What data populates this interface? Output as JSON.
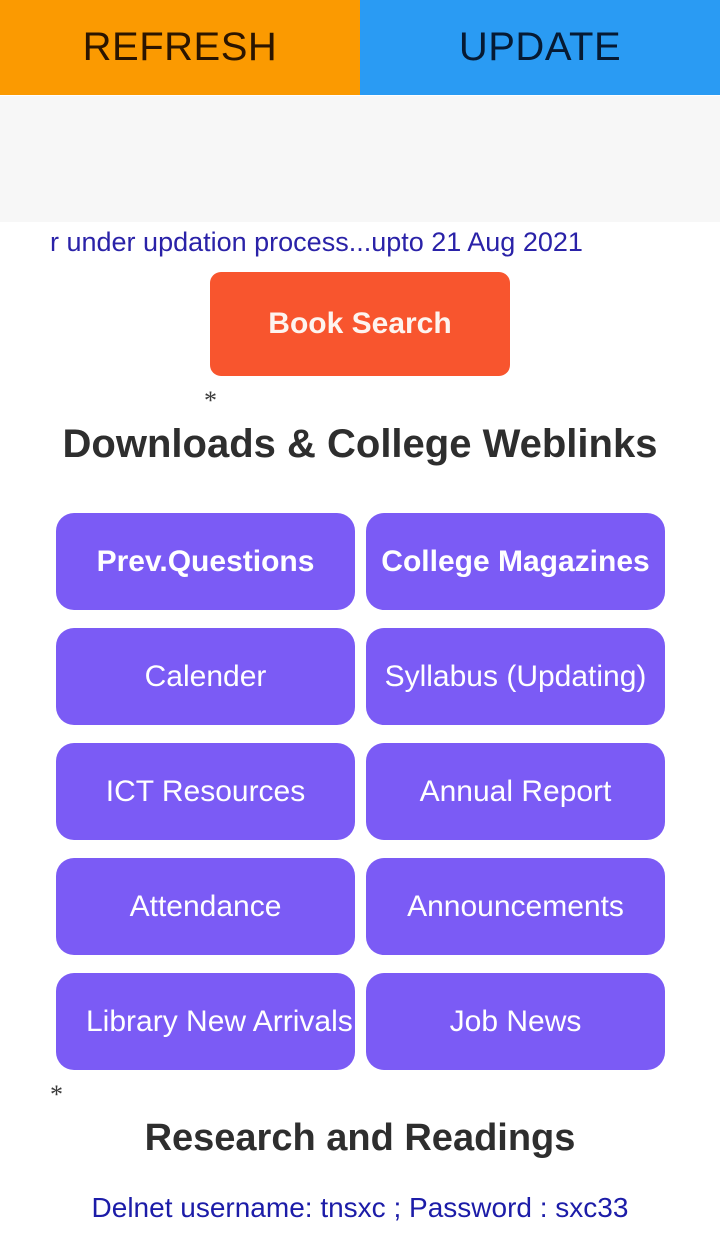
{
  "top_bar": {
    "refresh_label": "REFRESH",
    "update_label": "UPDATE",
    "refresh_color": "#FB9A01",
    "update_color": "#2A9BF3"
  },
  "notice": {
    "marquee_text": "r under updation process...upto 21 Aug 2021",
    "color": "#2A22A8"
  },
  "book_search": {
    "label": "Book Search",
    "color": "#F8552E"
  },
  "markers": {
    "asterisk": "*"
  },
  "downloads_section": {
    "heading": "Downloads & College Weblinks",
    "button_color": "#7B5BF5",
    "buttons": [
      {
        "label": "Prev.Questions",
        "bold": true,
        "overflow": false
      },
      {
        "label": "College Magazines",
        "bold": true,
        "overflow": false
      },
      {
        "label": "Calender",
        "bold": false,
        "overflow": false
      },
      {
        "label": "Syllabus (Updating)",
        "bold": false,
        "overflow": false
      },
      {
        "label": "ICT Resources",
        "bold": false,
        "overflow": false
      },
      {
        "label": "Annual Report",
        "bold": false,
        "overflow": false
      },
      {
        "label": "Attendance",
        "bold": false,
        "overflow": false
      },
      {
        "label": "Announcements",
        "bold": false,
        "overflow": false
      },
      {
        "label": "Library  New Arrivals",
        "bold": false,
        "overflow": true
      },
      {
        "label": "Job News",
        "bold": false,
        "overflow": false
      }
    ]
  },
  "research_section": {
    "heading": "Research and Readings",
    "credentials": "Delnet username: tnsxc ; Password : sxc33",
    "credentials_color": "#1C1CA8"
  }
}
